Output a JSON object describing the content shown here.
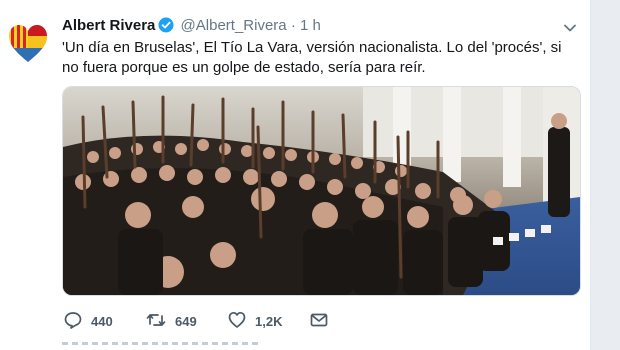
{
  "tweet": {
    "author_name": "Albert Rivera",
    "handle": "@Albert_Rivera",
    "separator": "·",
    "time": "1 h",
    "text": "'Un día en Bruselas', El Tío La Vara, versión nacionalista. Lo del 'procés', si no fuera porque es un golpe de estado, sería para reír.",
    "avatar_icon": "catalan-spanish-flag-heart",
    "verified_icon": "verified-badge-icon",
    "media_description_icon": "photo"
  },
  "actions": {
    "reply_count": "440",
    "retweet_count": "649",
    "like_count": "1,2K",
    "reply_icon": "reply-icon",
    "retweet_icon": "retweet-icon",
    "like_icon": "heart-icon",
    "dm_icon": "envelope-icon"
  },
  "colors": {
    "verified": "#1da1f2",
    "text": "#14171a",
    "secondary": "#657786",
    "accent_blue": "#3b5fa9"
  }
}
